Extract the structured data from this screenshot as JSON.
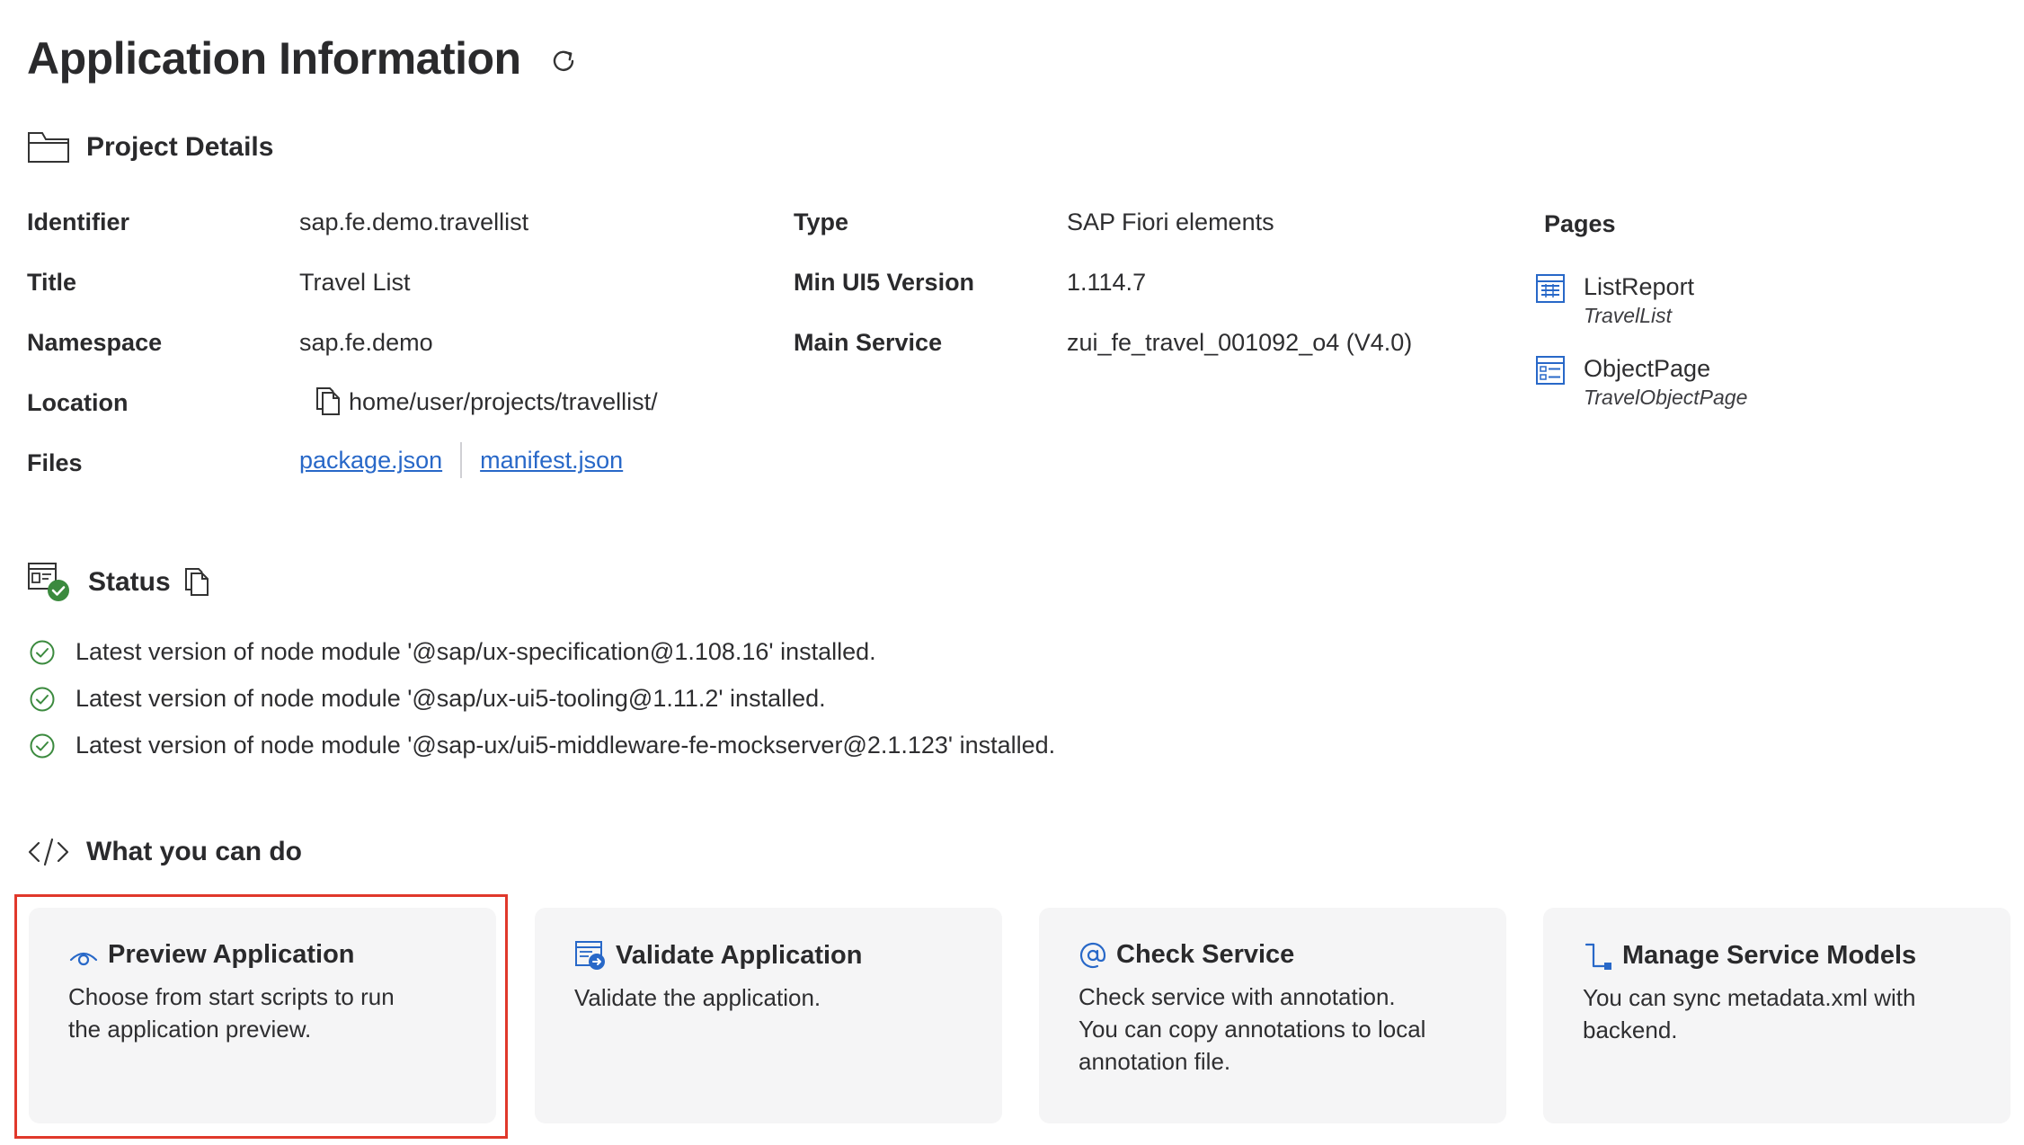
{
  "header": {
    "title": "Application Information"
  },
  "project_details": {
    "heading": "Project Details",
    "labels": {
      "identifier": "Identifier",
      "title": "Title",
      "namespace": "Namespace",
      "location": "Location",
      "files": "Files",
      "type": "Type",
      "min_ui5_version": "Min UI5 Version",
      "main_service": "Main Service",
      "pages": "Pages"
    },
    "values": {
      "identifier": "sap.fe.demo.travellist",
      "title": "Travel List",
      "namespace": "sap.fe.demo",
      "location": "home/user/projects/travellist/",
      "type": "SAP Fiori elements",
      "min_ui5_version": "1.114.7",
      "main_service": "zui_fe_travel_001092_o4 (V4.0)"
    },
    "files": [
      {
        "label": "package.json"
      },
      {
        "label": "manifest.json"
      }
    ],
    "pages": [
      {
        "name": "ListReport",
        "sub": "TravelList",
        "icon": "list-report-icon"
      },
      {
        "name": "ObjectPage",
        "sub": "TravelObjectPage",
        "icon": "object-page-icon"
      }
    ]
  },
  "status": {
    "heading": "Status",
    "items": [
      {
        "text": "Latest version of node module '@sap/ux-specification@1.108.16' installed."
      },
      {
        "text": "Latest version of node module '@sap/ux-ui5-tooling@1.11.2' installed."
      },
      {
        "text": "Latest version of node module '@sap-ux/ui5-middleware-fe-mockserver@2.1.123' installed."
      }
    ]
  },
  "actions": {
    "heading": "What you can do",
    "cards": [
      {
        "title": "Preview Application",
        "desc_line1": "Choose from start scripts to run",
        "desc_line2": "the application preview.",
        "desc_line3": "",
        "icon": "eye-icon"
      },
      {
        "title": "Validate Application",
        "desc_line1": "Validate the application.",
        "desc_line2": "",
        "desc_line3": "",
        "icon": "validate-icon"
      },
      {
        "title": "Check Service",
        "desc_line1": "Check service with annotation.",
        "desc_line2": "You can copy annotations to local",
        "desc_line3": "annotation file.",
        "icon": "at-icon"
      },
      {
        "title": "Manage Service Models",
        "desc_line1": "You can sync metadata.xml with",
        "desc_line2": "backend.",
        "desc_line3": "",
        "icon": "connector-icon"
      }
    ]
  },
  "colors": {
    "accent_blue": "#2868c8",
    "success_green": "#3b8a3e",
    "highlight_red": "#e0382b",
    "card_bg": "#f5f5f6"
  }
}
